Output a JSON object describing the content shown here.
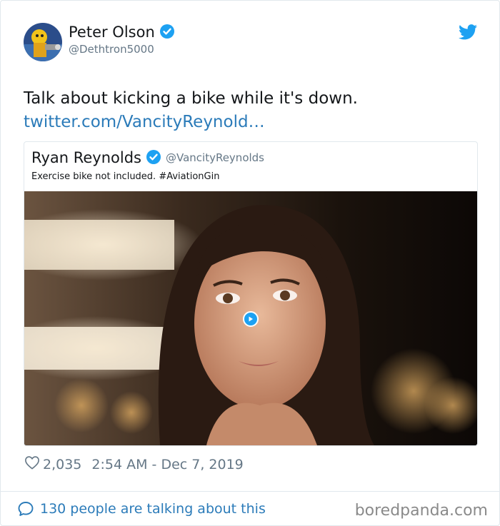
{
  "author": {
    "name": "Peter Olson",
    "handle": "@Dethtron5000"
  },
  "tweet": {
    "text": "Talk about kicking a bike while it's down.",
    "link": "twitter.com/VancityReynold…"
  },
  "quoted": {
    "name": "Ryan Reynolds",
    "handle": "@VancityReynolds",
    "text": "Exercise bike not included. #AviationGin"
  },
  "stats": {
    "likes": "2,035",
    "timestamp": "2:54 AM - Dec 7, 2019"
  },
  "footer": {
    "talking": "130 people are talking about this",
    "watermark": "boredpanda.com"
  },
  "colors": {
    "twitter_blue": "#1da1f2",
    "link": "#2b7bb9",
    "muted": "#657786"
  }
}
